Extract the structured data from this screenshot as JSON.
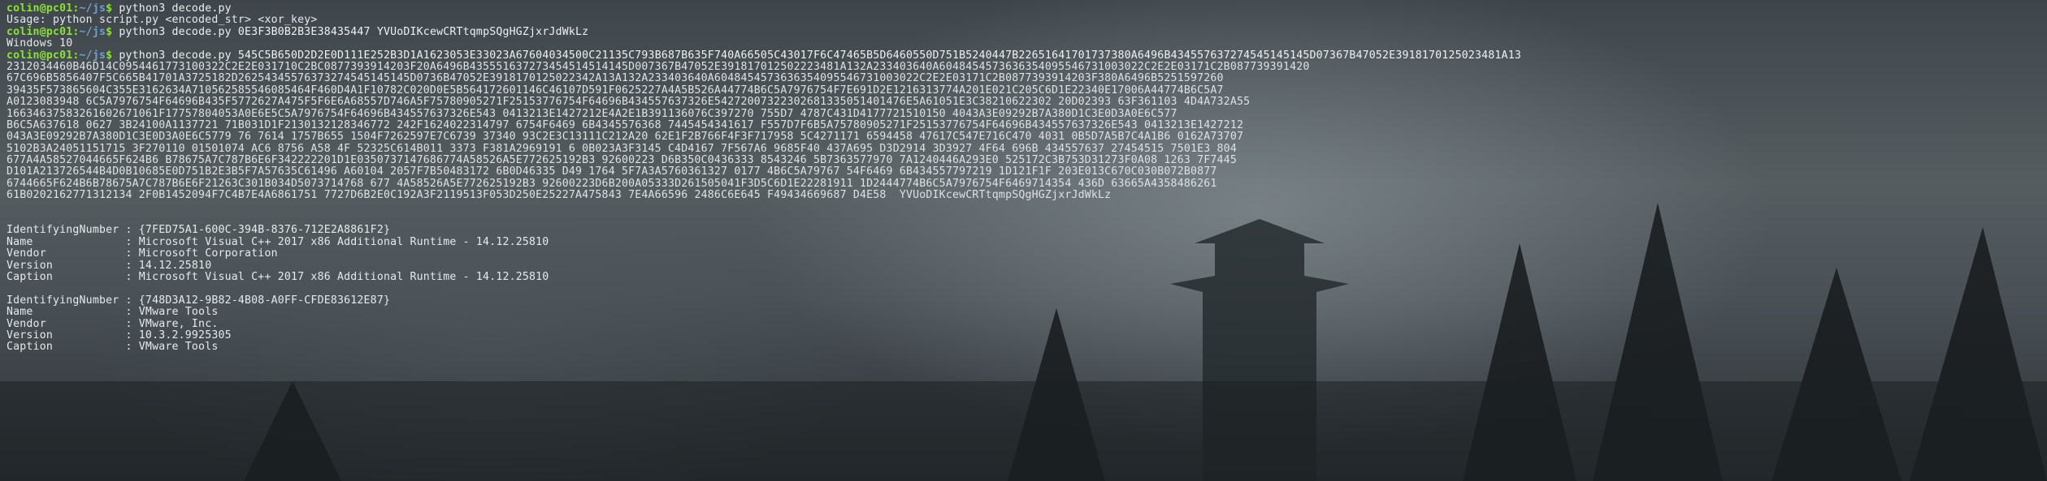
{
  "terminal": {
    "prompt_user": "colin@pc01",
    "prompt_sep": ":",
    "prompt_path": "~/js",
    "prompt_end": "$ ",
    "commands": [
      {
        "cmd": "python3 decode.py",
        "output": [
          "Usage: python script.py <encoded_str> <xor_key>"
        ]
      },
      {
        "cmd": "python3 decode.py 0E3F3B0B2B3E38435447 YVUoDIKcewCRTtqmpSQgHGZjxrJdWkLz",
        "output": [
          "Windows 10"
        ]
      },
      {
        "cmd": "python3 decode.py 545C5B650D2D2E0D111E252B3D1A1623053E33023A67604034500C21135C793B687B635F740A66505C43017F6C47465B5D6460550D751B5240447B22651641701737380A6496B434557637274545145145D07367B47052E3918170125023481A13"
      }
    ],
    "hex_lines": [
      "2312034460B46D14C0954461773100322C2E2E031710C2BC0877393914203F20A6496B435551637273454514514145D007367B47052E391817012502223481A132A233403640A6048454573636354095546731003022C2E2E03171C2B087739391420",
      "67C696B5856407F5C665B41701A3725182D26254345576373274545145145D0736B47052E3918170125022342A13A132A233403640A6048454573636354095546731003022C2E2E03171C2B0877393914203F380A6496B5251597260",
      "39435F573865604C355E3162634A710562585546085464F460D4A1F10782C020D0E5B564172601146C46107D591F0625227A4A5B526A44774B6C5A7976754F7E691D2E1216313774A201E021C205C6D1E22340E17006A44774B6C5A7",
      "A0123083948 6C5A7976754F64696B435F5772627A475F5F6E6A68557D746A5F75780905271F25153776754F64696B434557637326E54272007322302681335051401476E5A61051E3C38210622302 20D02393 63F361103 4D4A732A55",
      "16634637583261602671061F17757804053A0E6E5C5A7976754F64696B434557637326E543 0413213E1427212E4A2E1B391136076C397270 755D7 4787C431D4177721510150 4043A3E09292B7A380D1C3E0D3A0E6C577",
      "B6C5A637618 0627 3B24100A1137721 71B031D1F2130132128346772 242F1624022314797 6754F6469 6B4345576368 7445454341617 F557D7F6B5A75780905271F25153776754F64696B434557637326E543 0413213E1427212",
      "043A3E09292B7A380D1C3E0D3A0E6C5779 76 7614 1757B655 1504F7262597E7C6739 37340 93C2E3C13111C212A20 62E1F2B766F4F3F717958 5C4271171 6594458 47617C547E716C470 4031 0B5D7A5B7C4A1B6 0162A73707",
      "5102B3A24051151715 3F270110 01501074 AC6 8756 A58 4F 52325C614B011 3373 F381A2969191 6 0B023A3F3145 C4D4167 7F567A6 9685F40 437A695 D3D2914 3D3927 4F64 696B 434557637 27454515 7501E3 804",
      "677A4A58527044665F624B6 B78675A7C787B6E6F342222201D1E0350737147686774A58526A5E772625192B3 92600223 D6B350C0436333 8543246 5B7363577970 7A1240446A293E0 525172C3B753D31273F0A08 1263 7F7445",
      "D101A213726544B4D0B10685E0D751B2E3B5F7A57635C61496 A60104 2057F7B50483172 6B0D46335 D49 1764 5F7A3A5760361327 0177 4B6C5A79767 54F6469 6B434557797219 1D121F1F 203E013C670C030B072B0877",
      "6744665F624B6B78675A7C787B6E6F21263C301B034D5073714768 677 4A58526A5E772625192B3 92600223D6B200A05333D261505041F3D5C6D1E22281911 1D2444774B6C5A7976754F6469714354 436D 63665A4358486261",
      "61B0202162771312134 2F0B1452094F7C4B7E4A6861751 7727D6B2E0C192A3F2119513F053D250E25227A475843 7E4A66596 2486C6E645 F49434669687 D4E58"
    ],
    "hex_tail_key": "YVUoDIKcewCRTtqmpSQgHGZjxrJdWkLz",
    "products": [
      {
        "IdentifyingNumber": "{7FED75A1-600C-394B-8376-712E2A8861F2}",
        "Name": "Microsoft Visual C++ 2017 x86 Additional Runtime - 14.12.25810",
        "Vendor": "Microsoft Corporation",
        "Version": "14.12.25810",
        "Caption": "Microsoft Visual C++ 2017 x86 Additional Runtime - 14.12.25810"
      },
      {
        "IdentifyingNumber": "{748D3A12-9B82-4B08-A0FF-CFDE83612E87}",
        "Name": "VMware Tools",
        "Vendor": "VMware, Inc.",
        "Version": "10.3.2.9925305",
        "Caption": "VMware Tools"
      }
    ],
    "prop_keys": [
      "IdentifyingNumber",
      "Name",
      "Vendor",
      "Version",
      "Caption"
    ],
    "colors": {
      "user": "#8ae234",
      "path": "#729fcf",
      "text": "#e6eaec"
    }
  }
}
